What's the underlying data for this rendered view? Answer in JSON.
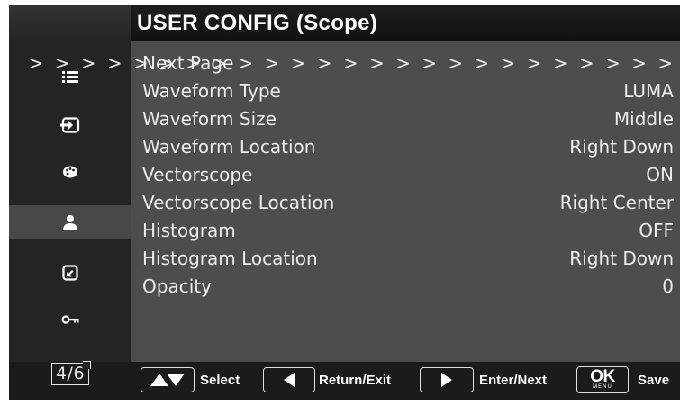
{
  "header": {
    "title": "USER CONFIG (Scope)"
  },
  "sidebar": {
    "items": [
      {
        "icon": "list-icon",
        "active": false
      },
      {
        "icon": "input-icon",
        "active": false
      },
      {
        "icon": "palette-icon",
        "active": false
      },
      {
        "icon": "user-icon",
        "active": true
      },
      {
        "icon": "external-icon",
        "active": false
      },
      {
        "icon": "key-icon",
        "active": false
      }
    ],
    "page_indicator": "4/6"
  },
  "menu": {
    "rows": [
      {
        "label": "Next Page",
        "value": "> > > > > > > > > > > > > > > > > > > > > > > > >"
      },
      {
        "label": "Waveform Type",
        "value": "LUMA"
      },
      {
        "label": "Waveform Size",
        "value": "Middle"
      },
      {
        "label": "Waveform Location",
        "value": "Right Down"
      },
      {
        "label": "Vectorscope",
        "value": "ON"
      },
      {
        "label": "Vectorscope Location",
        "value": "Right Center"
      },
      {
        "label": "Histogram",
        "value": "OFF"
      },
      {
        "label": "Histogram Location",
        "value": "Right Down"
      },
      {
        "label": "Opacity",
        "value": "0"
      }
    ]
  },
  "footer": {
    "select_label": "Select",
    "return_label": "Return/Exit",
    "enter_label": "Enter/Next",
    "ok_text": "OK",
    "ok_sub": "MENU",
    "save_label": "Save"
  },
  "colors": {
    "panel": "#4d4d4d",
    "sidebar": "#242424",
    "sidebar_active": "#484848",
    "text": "#ececec"
  }
}
